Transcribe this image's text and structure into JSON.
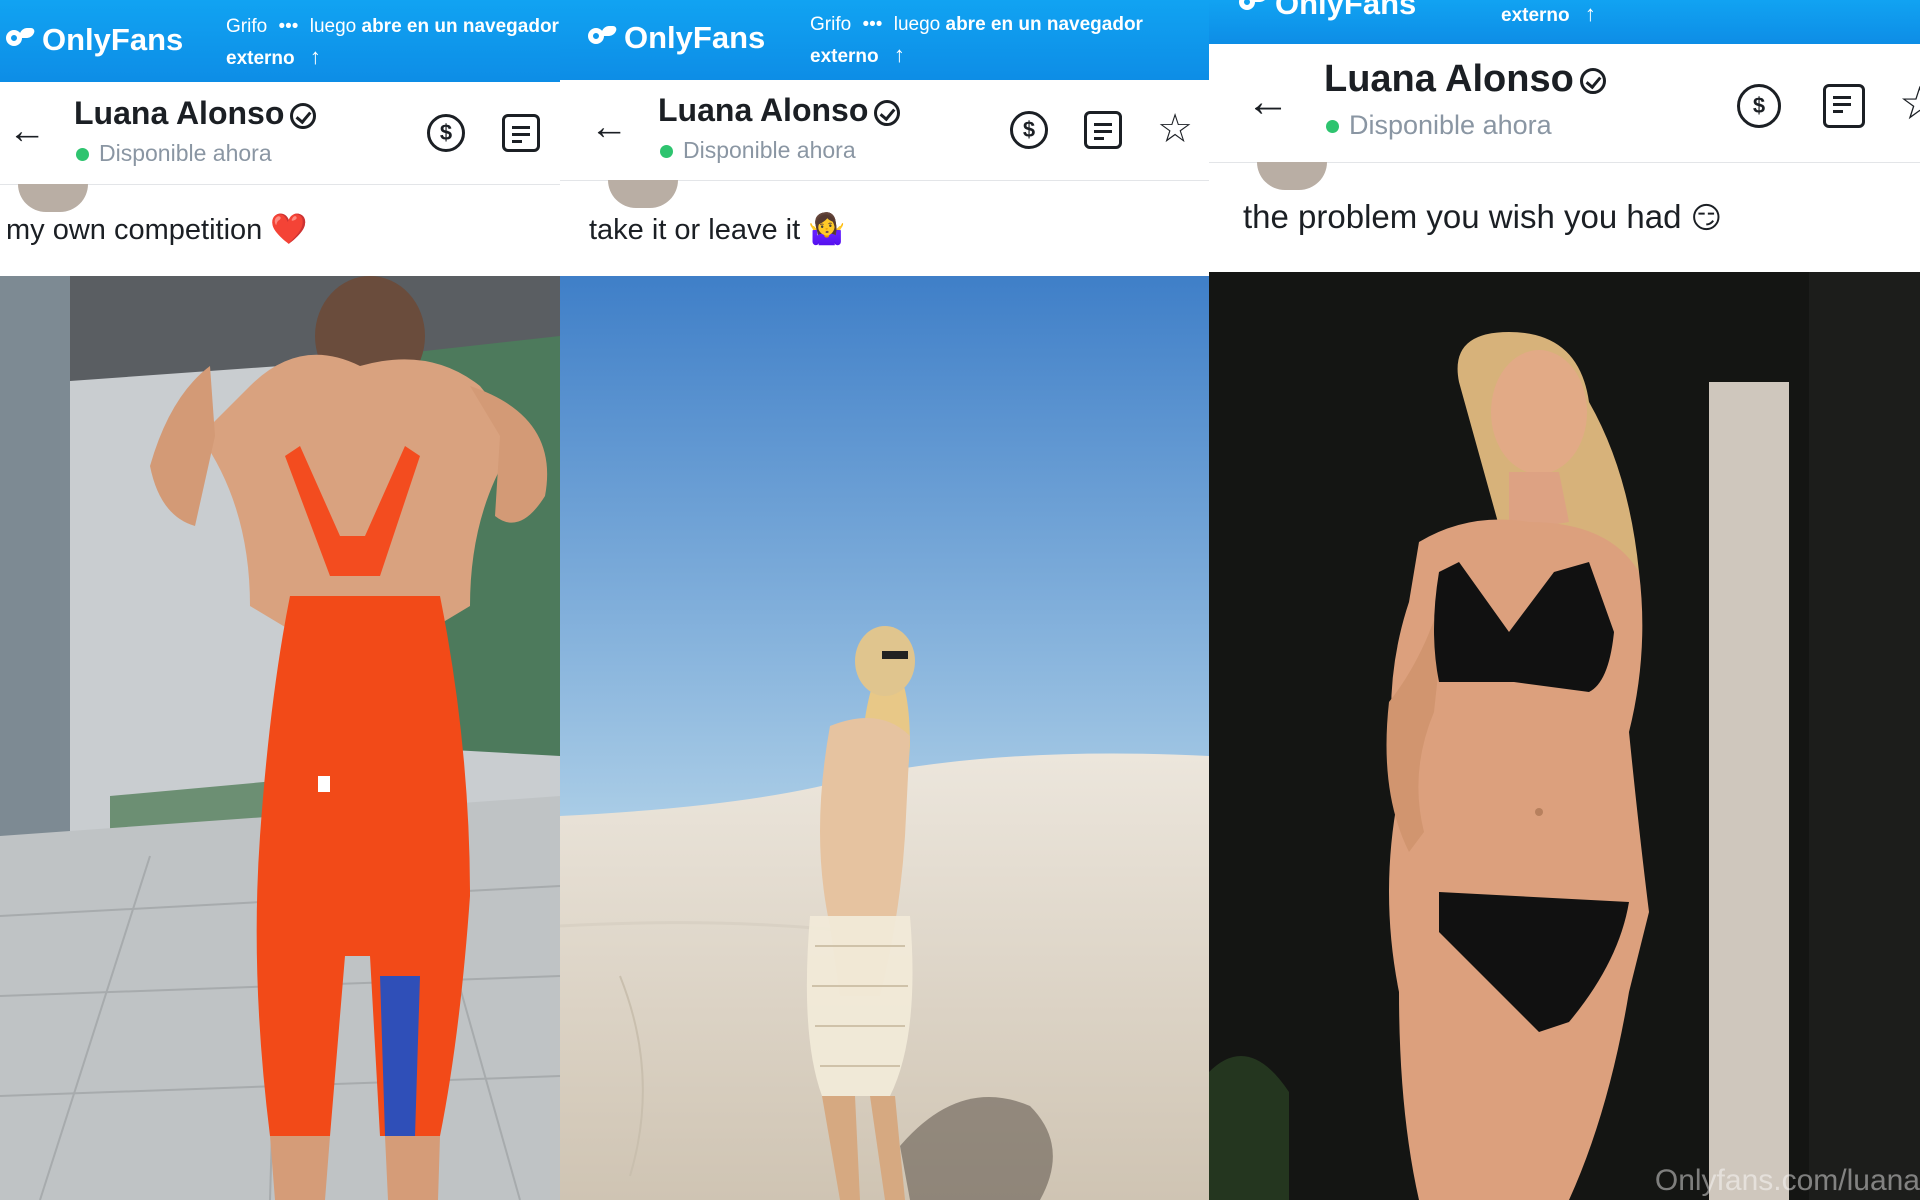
{
  "panels": [
    {
      "brand": "OnlyFans",
      "hint_line1_pre": "Grifo",
      "hint_dots": "•••",
      "hint_line1_mid": "luego",
      "hint_line1_bold": "abre en un navegador",
      "hint_line2_bold": "externo",
      "hint_arrow": "↑",
      "back_label": "←",
      "name": "Luana Alonso",
      "status": "Disponible ahora",
      "caption_text": "my own competition",
      "caption_emoji": "❤️"
    },
    {
      "brand": "OnlyFans",
      "hint_line1_pre": "Grifo",
      "hint_dots": "•••",
      "hint_line1_mid": "luego",
      "hint_line1_bold": "abre en un navegador",
      "hint_line2_bold": "externo",
      "hint_arrow": "↑",
      "back_label": "←",
      "name": "Luana Alonso",
      "status": "Disponible ahora",
      "star_label": "☆",
      "caption_text": "take it or leave it",
      "caption_emoji": "🤷‍♀️"
    },
    {
      "brand": "OnlyFans",
      "hint_line2_bold": "externo",
      "hint_arrow": "↑",
      "back_label": "←",
      "name": "Luana Alonso",
      "status": "Disponible ahora",
      "star_label": "☆",
      "caption_text": "the problem you wish you had",
      "caption_emoji": "😏",
      "watermark": "Onlyfans.com/luana"
    }
  ],
  "icons": {
    "tip": "dollar-circle-icon",
    "message": "message-square-icon",
    "star": "star-outline-icon",
    "verified": "verified-badge-icon"
  },
  "colors": {
    "brand_blue": "#0d8de6",
    "online_green": "#2ec46f",
    "muted_text": "#8a96a3"
  }
}
